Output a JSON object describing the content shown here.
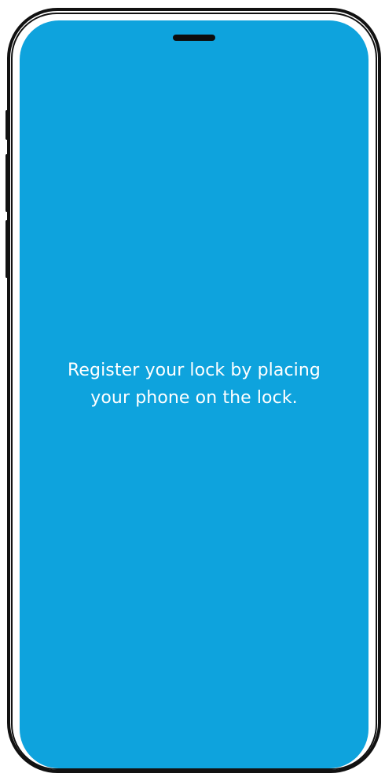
{
  "app": {
    "screen_background": "#0ea3dd",
    "message_line_1": "Register your lock by placing",
    "message_line_2": "your phone on the lock."
  },
  "device": {
    "frame_color": "#111111",
    "notch_icon": "speaker-notch"
  }
}
